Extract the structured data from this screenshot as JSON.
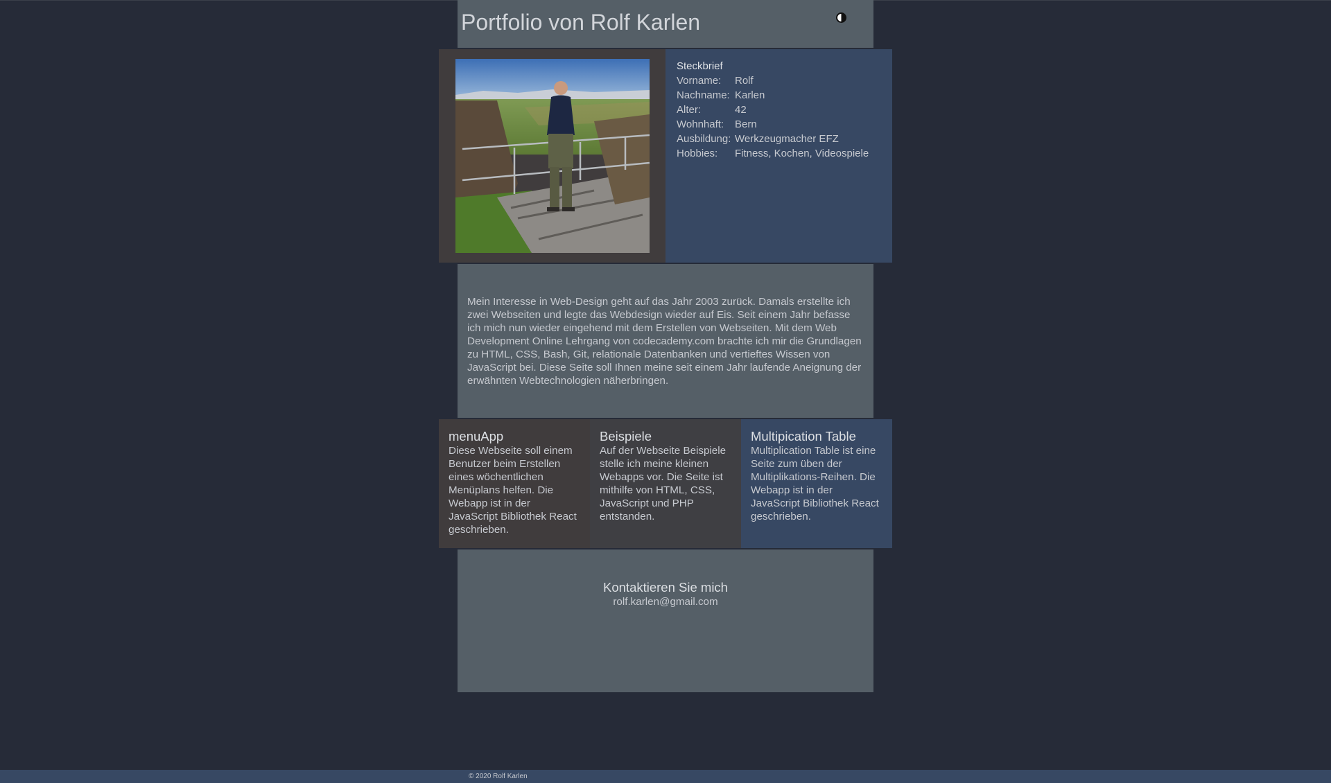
{
  "header": {
    "title": "Portfolio von Rolf Karlen",
    "theme_icon": "contrast-icon"
  },
  "profile": {
    "photo_alt": "Foto von Rolf Karlen",
    "title": "Steckbrief",
    "rows": [
      {
        "key": "Vorname:",
        "value": "Rolf"
      },
      {
        "key": "Nachname:",
        "value": "Karlen"
      },
      {
        "key": "Alter:",
        "value": "42"
      },
      {
        "key": "Wohnhaft:",
        "value": "Bern"
      },
      {
        "key": "Ausbildung:",
        "value": "Werkzeugmacher EFZ"
      },
      {
        "key": "Hobbies:",
        "value": "Fitness, Kochen, Videospiele"
      }
    ]
  },
  "intro": {
    "text": "Mein Interesse in Web-Design geht auf das Jahr 2003 zurück. Damals erstellte ich zwei Webseiten und legte das Webdesign wieder auf Eis. Seit einem Jahr befasse ich mich nun wieder eingehend mit dem Erstellen von Webseiten. Mit dem Web Development Online Lehrgang von codecademy.com brachte ich mir die Grundlagen zu HTML, CSS, Bash, Git, relationale Datenbanken und vertieftes Wissen von JavaScript bei. Diese Seite soll Ihnen meine seit einem Jahr laufende Aneignung der erwähnten Webtechnologien näherbringen."
  },
  "projects": [
    {
      "title": "menuApp",
      "text": "Diese Webseite soll einem Benutzer beim Erstellen eines wöchentlichen Menüplans helfen. Die Webapp ist in der JavaScript Bibliothek React geschrieben."
    },
    {
      "title": "Beispiele",
      "text": "Auf der Webseite Beispiele stelle ich meine kleinen Webapps vor. Die Seite ist mithilfe von HTML, CSS, JavaScript und PHP entstanden."
    },
    {
      "title": "Multipication Table",
      "text": "Multiplication Table ist eine Seite zum üben der Multiplikations-Reihen. Die Webapp ist in der JavaScript Bibliothek React geschrieben."
    }
  ],
  "contact": {
    "title": "Kontaktieren Sie mich",
    "email": "rolf.karlen@gmail.com"
  },
  "footer": {
    "copyright": "© 2020 Rolf Karlen"
  },
  "colors": {
    "page_bg": "#262b38",
    "panel_grey": "#555f67",
    "panel_dark": "#403c3d",
    "panel_blue": "#374863",
    "text": "#c6c9cf"
  }
}
